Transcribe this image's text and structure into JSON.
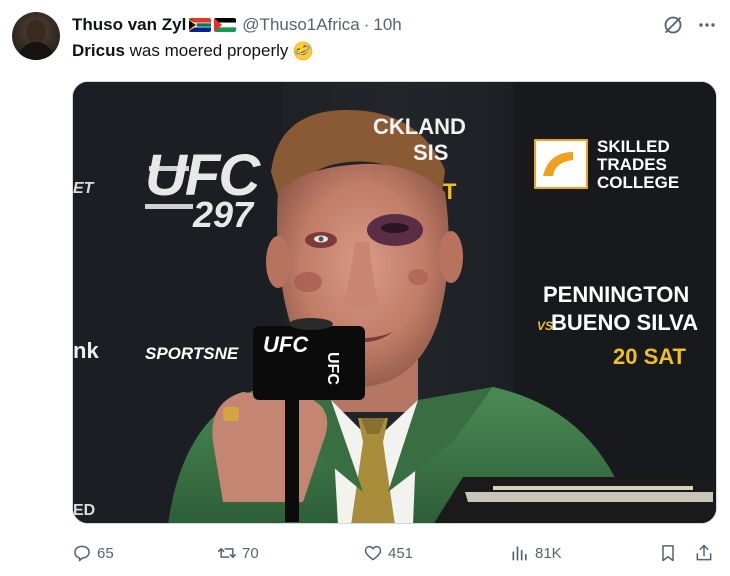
{
  "tweet": {
    "author": {
      "display_name": "Thuso van Zyl",
      "handle": "@Thuso1Africa",
      "flags": [
        "south-africa-flag-icon",
        "palestine-flag-icon"
      ]
    },
    "separator": "·",
    "timestamp": "10h",
    "text": {
      "bold": "Dricus",
      "rest": " was moered properly",
      "emoji": "rolling-on-floor-laughing-emoji"
    },
    "header_icons": [
      "grok-icon",
      "more-icon"
    ],
    "media": {
      "overlay_text": {
        "ufc_logo": "UFC",
        "ufc_number": "297",
        "edge_left": "ET",
        "nk": "nk",
        "sponsor_line1": "CKLAND",
        "sponsor_line2": "SIS",
        "yellow_letter": "T",
        "skilled": "SKILLED",
        "trades": "TRADES",
        "college": "COLLEGE",
        "pennington": "PENNINGTON",
        "vs": "VS",
        "bueno_silva": "BUENO SILVA",
        "sat": "20 SAT",
        "sportsnet": "SPORTSNE",
        "mic_ufc": "UFC",
        "mic_ufc_side": "UFC",
        "bottom_left": "ED"
      }
    },
    "actions": {
      "replies": "65",
      "retweets": "70",
      "likes": "451",
      "views": "81K"
    }
  },
  "colors": {
    "text_primary": "#0f1419",
    "text_secondary": "#536471",
    "border": "#cfd9de",
    "suit_green": "#3f7a4a",
    "tie_gold": "#a88d3a",
    "accent_yellow": "#f0c020"
  }
}
